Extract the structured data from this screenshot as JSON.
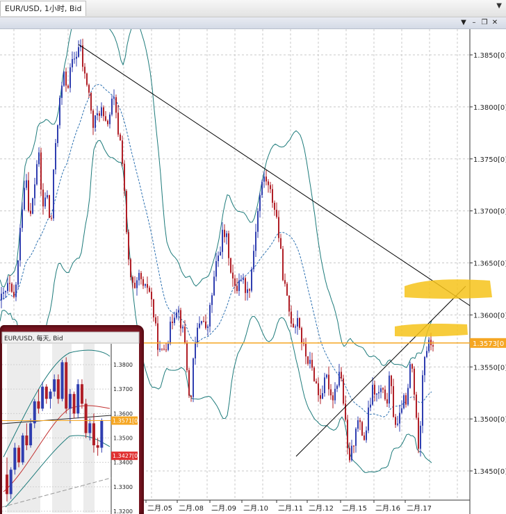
{
  "window": {
    "title": "EUR/USD, 1小时, Bid",
    "dropdown_icon": "chevron-down-icon",
    "controls": [
      "chevron-down-icon",
      "minimize-icon",
      "restore-icon",
      "close-icon"
    ]
  },
  "colors": {
    "bull": "#2f3eb0",
    "bear": "#b01e26",
    "band": "#1c7a7a",
    "trendline": "#000000",
    "price_line": "#f5a623",
    "highlight": "#f6c31a",
    "price_box": "#f5a623",
    "inset_frame": "#7a1622",
    "inset_low_box": "#e03030"
  },
  "chart_data": [
    {
      "type": "candlestick",
      "title": "EUR/USD, 1小时, Bid",
      "y_ticks": [
        "1.3850[0]",
        "1.3800[0]",
        "1.3750[0]",
        "1.3700[0]",
        "1.3650[0]",
        "1.3600[0]",
        "1.3550[0]",
        "1.3500[0]",
        "1.3450[0]"
      ],
      "y_tick_values": [
        1.385,
        1.38,
        1.375,
        1.37,
        1.365,
        1.36,
        1.355,
        1.35,
        1.345
      ],
      "ylim": [
        1.3415,
        1.3875
      ],
      "x_labels": [
        "二月.05",
        "二月.08",
        "二月.09",
        "二月.10",
        "二月.11",
        "二月.12",
        "二月.15",
        "二月.16",
        "二月.17"
      ],
      "current_price_label": "1.3573[0",
      "current_price": 1.3573,
      "grid": true,
      "indicators": [
        "bollinger-bands",
        "trendline-upper",
        "trendline-lower"
      ],
      "close_path": [
        [
          0,
          1.3614
        ],
        [
          6,
          1.362
        ],
        [
          12,
          1.363
        ],
        [
          18,
          1.361
        ],
        [
          24,
          1.364
        ],
        [
          30,
          1.37
        ],
        [
          36,
          1.374
        ],
        [
          42,
          1.369
        ],
        [
          48,
          1.372
        ],
        [
          54,
          1.376
        ],
        [
          60,
          1.37
        ],
        [
          66,
          1.372
        ],
        [
          72,
          1.368
        ],
        [
          78,
          1.376
        ],
        [
          84,
          1.38
        ],
        [
          90,
          1.383
        ],
        [
          96,
          1.382
        ],
        [
          102,
          1.384
        ],
        [
          108,
          1.385
        ],
        [
          114,
          1.386
        ],
        [
          120,
          1.383
        ],
        [
          126,
          1.382
        ],
        [
          132,
          1.378
        ],
        [
          138,
          1.379
        ],
        [
          144,
          1.38
        ],
        [
          150,
          1.378
        ],
        [
          156,
          1.379
        ],
        [
          162,
          1.381
        ],
        [
          168,
          1.378
        ],
        [
          174,
          1.376
        ],
        [
          178,
          1.372
        ],
        [
          182,
          1.366
        ],
        [
          188,
          1.363
        ],
        [
          194,
          1.362
        ],
        [
          200,
          1.364
        ],
        [
          206,
          1.362
        ],
        [
          212,
          1.363
        ],
        [
          218,
          1.361
        ],
        [
          224,
          1.358
        ],
        [
          230,
          1.356
        ],
        [
          236,
          1.357
        ],
        [
          242,
          1.358
        ],
        [
          248,
          1.36
        ],
        [
          254,
          1.361
        ],
        [
          260,
          1.359
        ],
        [
          266,
          1.357
        ],
        [
          272,
          1.351
        ],
        [
          278,
          1.356
        ],
        [
          284,
          1.359
        ],
        [
          290,
          1.36
        ],
        [
          296,
          1.358
        ],
        [
          302,
          1.361
        ],
        [
          308,
          1.364
        ],
        [
          314,
          1.366
        ],
        [
          320,
          1.368
        ],
        [
          326,
          1.367
        ],
        [
          332,
          1.364
        ],
        [
          338,
          1.362
        ],
        [
          344,
          1.364
        ],
        [
          350,
          1.363
        ],
        [
          356,
          1.362
        ],
        [
          362,
          1.365
        ],
        [
          368,
          1.369
        ],
        [
          374,
          1.372
        ],
        [
          380,
          1.3735
        ],
        [
          386,
          1.372
        ],
        [
          392,
          1.371
        ],
        [
          398,
          1.369
        ],
        [
          404,
          1.365
        ],
        [
          410,
          1.362
        ],
        [
          416,
          1.36
        ],
        [
          422,
          1.359
        ],
        [
          428,
          1.36
        ],
        [
          434,
          1.357
        ],
        [
          440,
          1.356
        ],
        [
          446,
          1.355
        ],
        [
          452,
          1.354
        ],
        [
          458,
          1.352
        ],
        [
          464,
          1.353
        ],
        [
          470,
          1.354
        ],
        [
          476,
          1.352
        ],
        [
          482,
          1.353
        ],
        [
          488,
          1.355
        ],
        [
          494,
          1.351
        ],
        [
          500,
          1.346
        ],
        [
          506,
          1.347
        ],
        [
          512,
          1.35
        ],
        [
          518,
          1.349
        ],
        [
          524,
          1.348
        ],
        [
          530,
          1.351
        ],
        [
          536,
          1.353
        ],
        [
          542,
          1.352
        ],
        [
          548,
          1.353
        ],
        [
          554,
          1.351
        ],
        [
          560,
          1.354
        ],
        [
          566,
          1.35
        ],
        [
          572,
          1.349
        ],
        [
          578,
          1.352
        ],
        [
          584,
          1.351
        ],
        [
          590,
          1.356
        ],
        [
          596,
          1.352
        ],
        [
          600,
          1.347
        ],
        [
          604,
          1.35
        ],
        [
          608,
          1.356
        ],
        [
          614,
          1.357
        ],
        [
          620,
          1.3573
        ]
      ]
    },
    {
      "type": "candlestick",
      "title": "EUR/USD, 每天, Bid",
      "y_ticks": [
        "1.3800",
        "1.3700",
        "1.3600",
        "1.3500",
        "1.3400",
        "1.3300",
        "1.3200"
      ],
      "y_tick_values": [
        1.38,
        1.37,
        1.36,
        1.35,
        1.34,
        1.33,
        1.32
      ],
      "ylim": [
        1.3185,
        1.3885
      ],
      "current_price_label": "1.3571[0",
      "current_price": 1.3571,
      "low_price_label": "1.3427[0",
      "low_price": 1.3427,
      "grid": true,
      "candles": [
        [
          1.335,
          1.342,
          1.324,
          1.327
        ],
        [
          1.327,
          1.338,
          1.325,
          1.337
        ],
        [
          1.337,
          1.348,
          1.335,
          1.346
        ],
        [
          1.346,
          1.347,
          1.338,
          1.34
        ],
        [
          1.34,
          1.352,
          1.339,
          1.351
        ],
        [
          1.351,
          1.356,
          1.345,
          1.347
        ],
        [
          1.347,
          1.358,
          1.346,
          1.356
        ],
        [
          1.356,
          1.366,
          1.354,
          1.365
        ],
        [
          1.365,
          1.37,
          1.36,
          1.362
        ],
        [
          1.362,
          1.373,
          1.361,
          1.371
        ],
        [
          1.371,
          1.372,
          1.364,
          1.366
        ],
        [
          1.366,
          1.37,
          1.362,
          1.369
        ],
        [
          1.369,
          1.376,
          1.367,
          1.374
        ],
        [
          1.374,
          1.376,
          1.364,
          1.366
        ],
        [
          1.366,
          1.382,
          1.365,
          1.381
        ],
        [
          1.381,
          1.383,
          1.36,
          1.362
        ],
        [
          1.362,
          1.37,
          1.356,
          1.368
        ],
        [
          1.368,
          1.369,
          1.358,
          1.36
        ],
        [
          1.36,
          1.374,
          1.358,
          1.372
        ],
        [
          1.372,
          1.374,
          1.362,
          1.364
        ],
        [
          1.364,
          1.366,
          1.35,
          1.352
        ],
        [
          1.352,
          1.358,
          1.349,
          1.356
        ],
        [
          1.356,
          1.36,
          1.344,
          1.347
        ],
        [
          1.347,
          1.35,
          1.3427,
          1.346
        ],
        [
          1.346,
          1.358,
          1.344,
          1.3571
        ]
      ]
    }
  ]
}
